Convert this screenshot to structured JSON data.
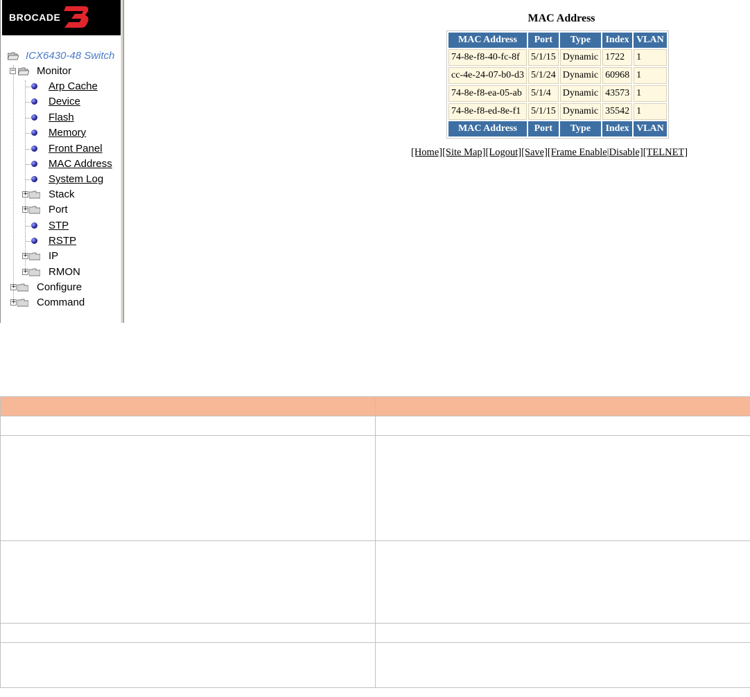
{
  "brand": {
    "logo_text": "BROCADE"
  },
  "tree": {
    "root_label": "ICX6430-48 Switch",
    "monitor_label": "Monitor",
    "items": [
      {
        "label": "Arp Cache"
      },
      {
        "label": "Device"
      },
      {
        "label": "Flash"
      },
      {
        "label": "Memory"
      },
      {
        "label": "Front Panel"
      },
      {
        "label": "MAC Address"
      },
      {
        "label": "System Log"
      },
      {
        "label": "Stack"
      },
      {
        "label": "Port"
      },
      {
        "label": "STP"
      },
      {
        "label": "RSTP"
      },
      {
        "label": "IP"
      },
      {
        "label": "RMON"
      }
    ],
    "configure_label": "Configure",
    "command_label": "Command"
  },
  "mac_page": {
    "title": "MAC Address",
    "columns": [
      "MAC Address",
      "Port",
      "Type",
      "Index",
      "VLAN"
    ],
    "rows": [
      [
        "74-8e-f8-40-fc-8f",
        "5/1/15",
        "Dynamic",
        "1722",
        "1"
      ],
      [
        "cc-4e-24-07-b0-d3",
        "5/1/24",
        "Dynamic",
        "60968",
        "1"
      ],
      [
        "74-8e-f8-ea-05-ab",
        "5/1/4",
        "Dynamic",
        "43573",
        "1"
      ],
      [
        "74-8e-f8-ed-8e-f1",
        "5/1/15",
        "Dynamic",
        "35542",
        "1"
      ]
    ],
    "links": [
      "[Home]",
      "[Site Map]",
      "[Logout]",
      "[Save]",
      "[Frame Enable",
      "Disable]",
      "[TELNET]"
    ]
  },
  "colors": {
    "table_header": "#3d6fa3",
    "table_cell": "#fff8e0",
    "doc_header": "#f6b896"
  }
}
